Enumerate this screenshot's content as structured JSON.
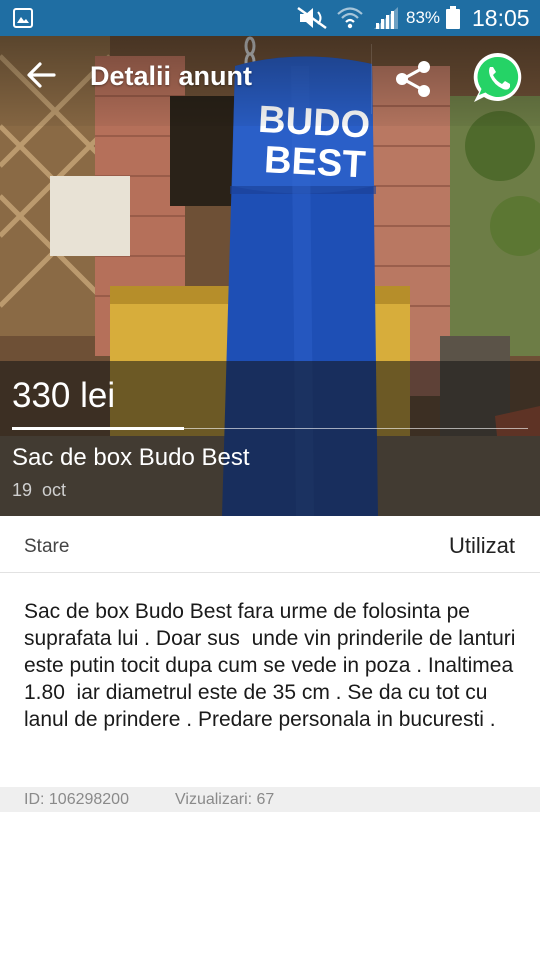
{
  "status_bar": {
    "battery": "83%",
    "time": "18:05",
    "icons": [
      "gallery-icon",
      "mute-icon",
      "wifi-icon",
      "signal-icon",
      "battery-icon"
    ]
  },
  "header": {
    "title": "Detalii anunt",
    "icons": [
      "back-arrow-icon",
      "share-icon",
      "whatsapp-icon"
    ]
  },
  "ad": {
    "price": "330 lei",
    "title": "Sac de box Budo Best",
    "date": "19  oct",
    "photo_brand_text": [
      "BUDO",
      "BEST"
    ]
  },
  "details": [
    {
      "label": "Stare",
      "value": "Utilizat"
    }
  ],
  "description": "Sac de box Budo Best fara urme de folosinta pe suprafata lui . Doar sus  unde vin prinderile de lanturi este putin tocit dupa cum se vede in poza . Inaltimea 1.80  iar diametrul este de 35 cm . Se da cu tot cu lanul de prindere . Predare personala in bucuresti .",
  "meta": {
    "id": "ID: 106298200",
    "views": "Vizualizari: 67"
  },
  "colors": {
    "status_bar": "#1f6ea3",
    "whatsapp": "#25d366",
    "punching_bag": "#1e4fb5"
  }
}
